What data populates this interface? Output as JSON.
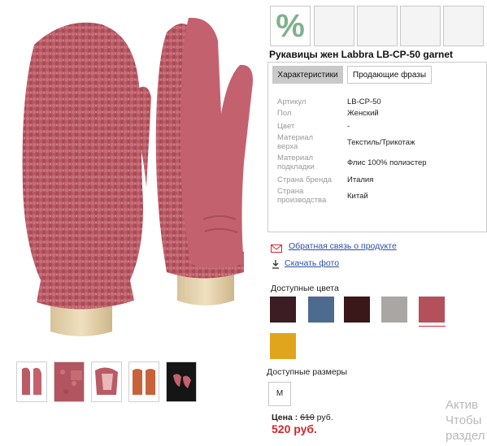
{
  "product": {
    "title": "Рукавицы жен Labbra LB-CP-50 garnet",
    "discount_symbol": "%"
  },
  "tabs": [
    {
      "label": "Характеристики",
      "active": true
    },
    {
      "label": "Продающие фразы",
      "active": false
    }
  ],
  "specs": [
    {
      "label": "Артикул",
      "value": "LB-CP-50"
    },
    {
      "label": "Пол",
      "value": "Женский"
    },
    {
      "label": "Цвет",
      "value": "-"
    },
    {
      "label": "Материал верха",
      "value": "Текстиль/Трикотаж"
    },
    {
      "label": "Материал подкладки",
      "value": "Флис 100% полиэстер"
    },
    {
      "label": "Страна бренда",
      "value": "Италия"
    },
    {
      "label": "Страна производства",
      "value": "Китай"
    }
  ],
  "links": {
    "feedback": "Обратная связь о продукте",
    "download": "Скачать фото"
  },
  "colors": {
    "label": "Доступные цвета",
    "swatches": [
      "#3b1d23",
      "#4d6a8f",
      "#3a1718",
      "#a9a6a3",
      "#b3505c",
      "#e0a51d"
    ],
    "selected_index": 4
  },
  "sizes": {
    "label": "Доступные размеры",
    "items": [
      "M"
    ]
  },
  "price": {
    "label": "Цена :",
    "old": "610",
    "currency": "руб.",
    "new": "520 руб."
  },
  "watermark": {
    "line1": "Актив",
    "line2": "Чтобы",
    "line3": "раздел"
  },
  "theme": {
    "accent_red": "#d2262b",
    "link_blue": "#2a4ea8",
    "product_color": "#b95b66"
  }
}
